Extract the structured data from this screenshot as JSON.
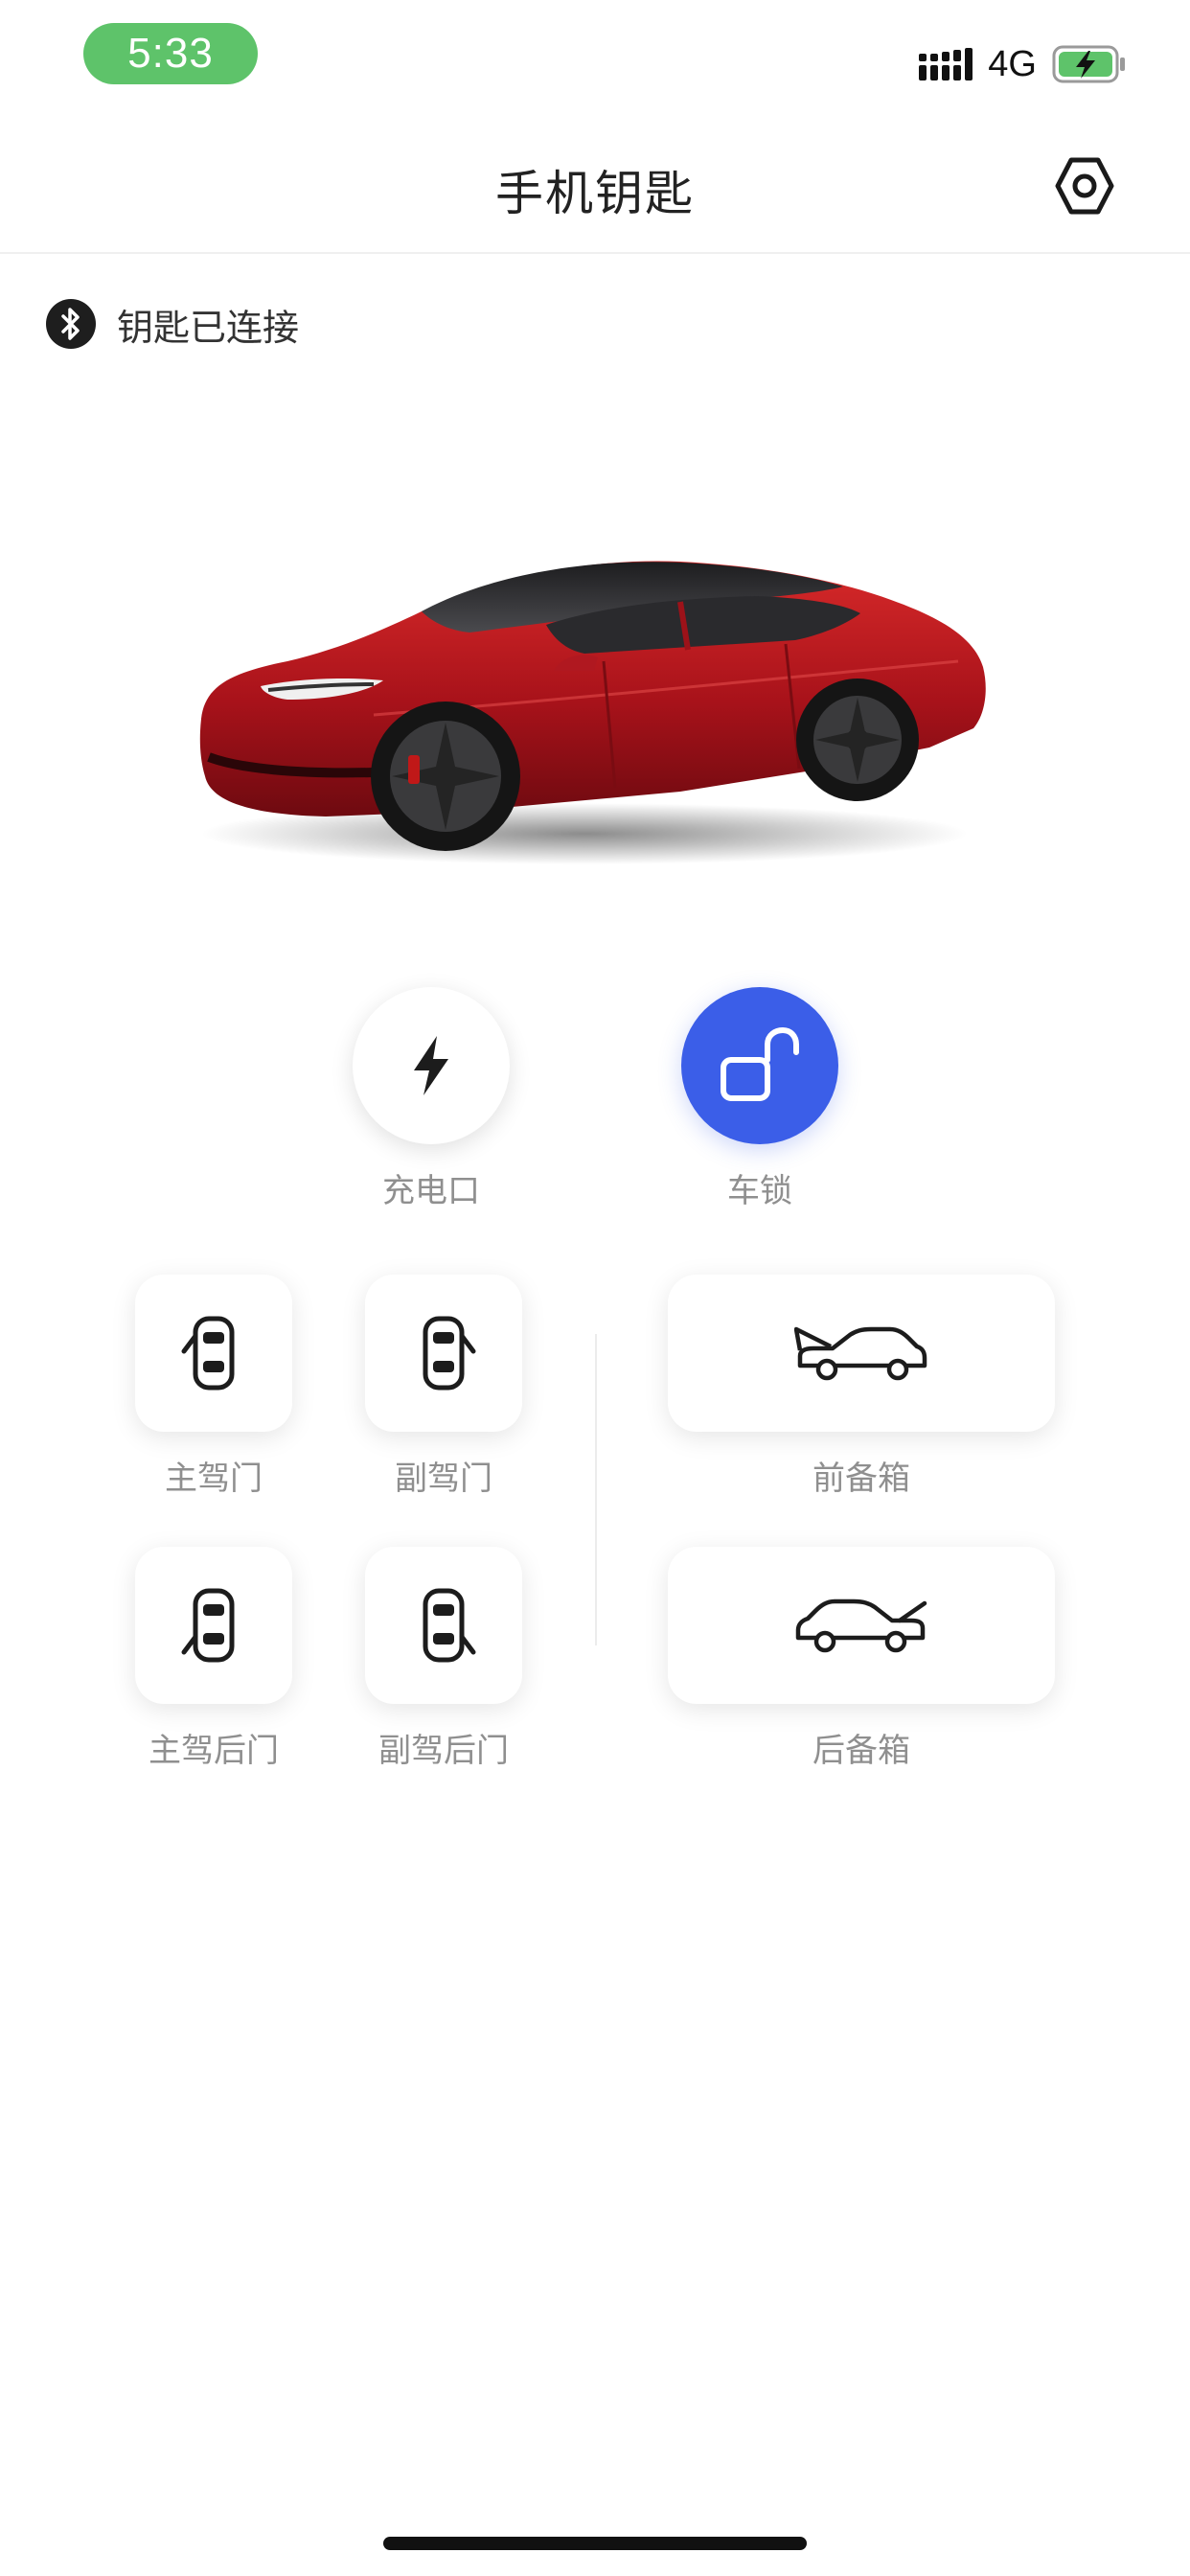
{
  "status_bar": {
    "time": "5:33",
    "network": "4G",
    "signal_icon": "signal-bars-icon",
    "battery_icon": "battery-charging-icon",
    "battery_color": "#5ec36a"
  },
  "header": {
    "title": "手机钥匙",
    "settings_icon": "settings-hex-icon"
  },
  "connection": {
    "icon": "bluetooth-icon",
    "status": "钥匙已连接"
  },
  "vehicle": {
    "image": "red-sedan-image",
    "color": "#b3161c"
  },
  "actions": {
    "charge_port": {
      "label": "充电口",
      "icon": "lightning-bolt-icon"
    },
    "car_lock": {
      "label": "车锁",
      "icon": "unlocked-padlock-icon",
      "accent": "#3b5ee8"
    }
  },
  "controls": {
    "driver_door": {
      "label": "主驾门",
      "icon": "driver-door-icon"
    },
    "passenger_door": {
      "label": "副驾门",
      "icon": "passenger-door-icon"
    },
    "driver_rear_door": {
      "label": "主驾后门",
      "icon": "driver-rear-door-icon"
    },
    "passenger_rear_door": {
      "label": "副驾后门",
      "icon": "passenger-rear-door-icon"
    },
    "front_trunk": {
      "label": "前备箱",
      "icon": "front-trunk-icon"
    },
    "rear_trunk": {
      "label": "后备箱",
      "icon": "rear-trunk-icon"
    }
  }
}
